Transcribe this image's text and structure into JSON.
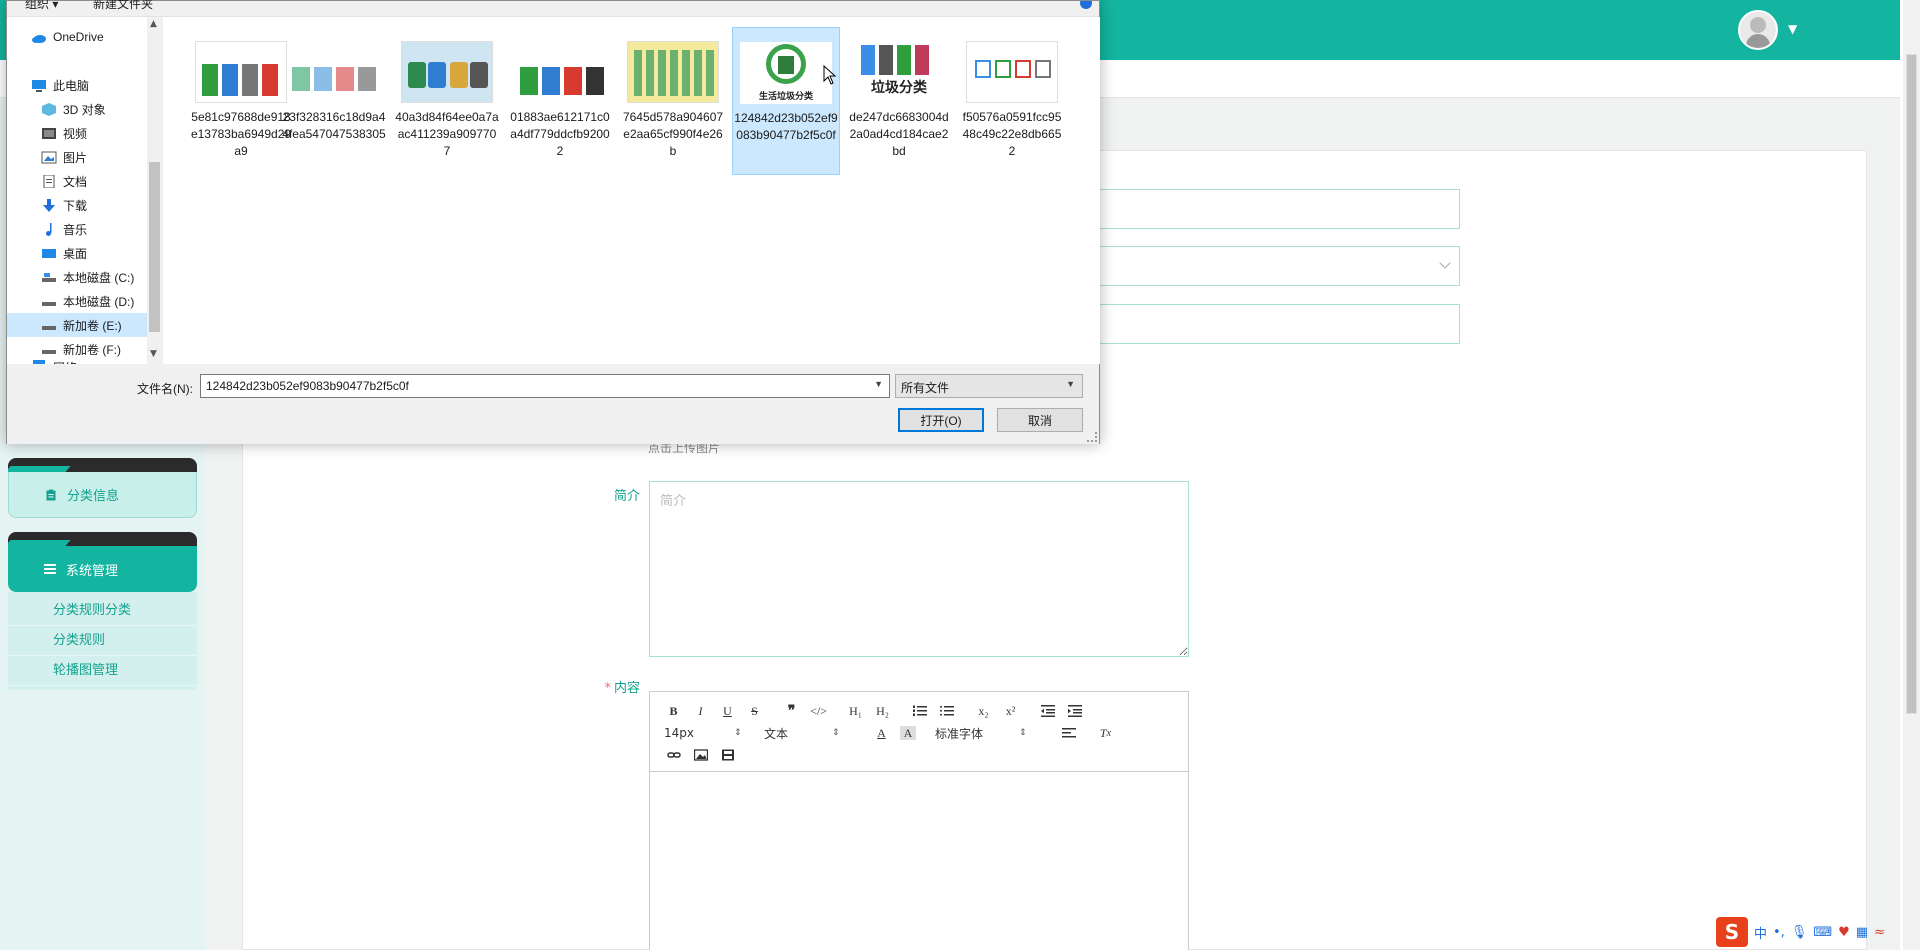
{
  "dialog": {
    "top_strip": [
      "组织 ▾",
      "新建文件夹"
    ],
    "nav_items": [
      {
        "label": "OneDrive",
        "icon": "cloud-icon"
      },
      {
        "label": "此电脑",
        "icon": "computer-icon"
      },
      {
        "label": "3D 对象",
        "icon": "cube-icon"
      },
      {
        "label": "视频",
        "icon": "video-icon"
      },
      {
        "label": "图片",
        "icon": "picture-icon"
      },
      {
        "label": "文档",
        "icon": "document-icon"
      },
      {
        "label": "下载",
        "icon": "download-icon"
      },
      {
        "label": "音乐",
        "icon": "music-icon"
      },
      {
        "label": "桌面",
        "icon": "desktop-icon"
      },
      {
        "label": "本地磁盘 (C:)",
        "icon": "drive-icon"
      },
      {
        "label": "本地磁盘 (D:)",
        "icon": "drive-icon"
      },
      {
        "label": "新加卷 (E:)",
        "icon": "drive-icon",
        "selected": true
      },
      {
        "label": "新加卷 (F:)",
        "icon": "drive-icon"
      },
      {
        "label": "网络",
        "icon": "network-icon"
      }
    ],
    "files": [
      {
        "name": "5e81c97688de918e13783ba6949d29a9"
      },
      {
        "name": "23f328316c18d9a44fea547047538305"
      },
      {
        "name": "40a3d84f64ee0a7aac411239a9097707"
      },
      {
        "name": "01883ae612171c0a4df779ddcfb92002"
      },
      {
        "name": "7645d578a904607e2aa65cf990f4e26b"
      },
      {
        "name": "124842d23b052ef9083b90477b2f5c0f",
        "selected": true,
        "thumb_text": "生活垃圾分类"
      },
      {
        "name": "de247dc6683004d2a0ad4cd184cae2bd",
        "thumb_text": "垃圾分类"
      },
      {
        "name": "f50576a0591fcc9548c49c22e8db6652"
      }
    ],
    "filename_label": "文件名(N):",
    "filename_value": "124842d23b052ef9083b90477b2f5c0f",
    "filetype_value": "所有文件",
    "open_label": "打开(O)",
    "cancel_label": "取消"
  },
  "sidebar": {
    "menu1": "分类信息",
    "menu2": "系统管理",
    "submenu": [
      "分类规则分类",
      "分类规则",
      "轮播图管理"
    ]
  },
  "form": {
    "upload_hint": "点击上传图片",
    "intro_label": "简介",
    "intro_placeholder": "简介",
    "content_label": "内容",
    "required_mark": "*"
  },
  "editor": {
    "font_size": "14px",
    "paragraph": "文本",
    "font_family": "标准字体",
    "buttons": [
      "B",
      "I",
      "U",
      "S",
      "❞",
      "</>",
      "H₁",
      "H₂",
      "ol",
      "ul",
      "x₂",
      "x²",
      "outdent",
      "indent"
    ]
  },
  "ime": {
    "label": "中"
  },
  "colors": {
    "accent": "#13b5a0",
    "selection": "#cce8ff"
  }
}
